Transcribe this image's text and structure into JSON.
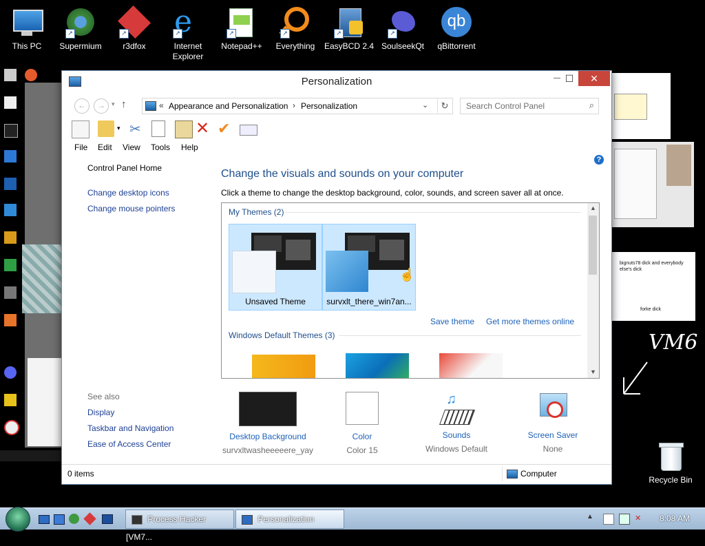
{
  "desktop": {
    "icons": [
      {
        "label": "This PC",
        "icon": "this-pc-icon"
      },
      {
        "label": "Supermium",
        "icon": "supermium-icon"
      },
      {
        "label": "r3dfox",
        "icon": "r3dfox-icon"
      },
      {
        "label": "Internet Explorer",
        "icon": "internet-explorer-icon"
      },
      {
        "label": "Notepad++",
        "icon": "notepad-plus-plus-icon"
      },
      {
        "label": "Everything",
        "icon": "everything-icon"
      },
      {
        "label": "EasyBCD 2.4",
        "icon": "easybcd-icon"
      },
      {
        "label": "SoulseekQt",
        "icon": "soulseekqt-icon"
      },
      {
        "label": "qBittorrent",
        "icon": "qbittorrent-icon"
      }
    ],
    "recycle_bin_label": "Recycle Bin",
    "handwriting": "VM6",
    "wallpaper_note_1": "bignuts78 dick and everybody else's dick",
    "wallpaper_note_2": "forke dick"
  },
  "window": {
    "title": "Personalization",
    "buttons": {
      "minimize": "—",
      "maximize": "☐",
      "close": "✕"
    },
    "address": {
      "chevrons": "«",
      "crumb1": "Appearance and Personalization",
      "sep": "›",
      "crumb2": "Personalization"
    },
    "search_placeholder": "Search Control Panel",
    "menu": [
      "File",
      "Edit",
      "View",
      "Tools",
      "Help"
    ],
    "left_nav": {
      "home": "Control Panel Home",
      "links": [
        "Change desktop icons",
        "Change mouse pointers"
      ]
    },
    "see_also": {
      "title": "See also",
      "links": [
        "Display",
        "Taskbar and Navigation",
        "Ease of Access Center"
      ]
    },
    "heading": "Change the visuals and sounds on your computer",
    "subheading": "Click a theme to change the desktop background, color, sounds, and screen saver all at once.",
    "my_themes": {
      "title": "My Themes (2)",
      "items": [
        "Unsaved Theme",
        "survxlt_there_win7an..."
      ]
    },
    "save_theme": "Save theme",
    "get_more": "Get more themes online",
    "default_themes_title": "Windows Default Themes (3)",
    "bottom": [
      {
        "label": "Desktop Background",
        "sub": "survxltwasheeeeere_yay"
      },
      {
        "label": "Color",
        "sub": "Color 15"
      },
      {
        "label": "Sounds",
        "sub": "Windows Default"
      },
      {
        "label": "Screen Saver",
        "sub": "None"
      }
    ],
    "status_left": "0 items",
    "status_right": "Computer",
    "help_glyph": "?"
  },
  "taskbar": {
    "tasks": [
      "Process Hacker [VM7...",
      "Personalization"
    ],
    "clock": "8:08 AM"
  },
  "colors": {
    "accent": "#1e4e8c",
    "selection": "#cce8ff",
    "close_red": "#e81123"
  }
}
